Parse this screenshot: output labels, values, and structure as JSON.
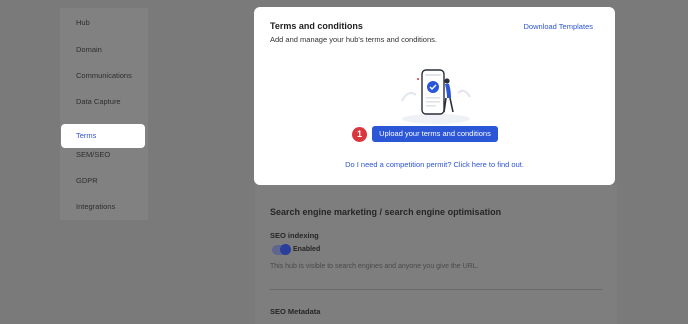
{
  "sidebar": {
    "items": [
      {
        "label": "Hub"
      },
      {
        "label": "Domain"
      },
      {
        "label": "Communications"
      },
      {
        "label": "Data Capture"
      },
      {
        "label": "Terms"
      },
      {
        "label": "SEM/SEO"
      },
      {
        "label": "GDPR"
      },
      {
        "label": "Integrations"
      }
    ],
    "active_index": 4
  },
  "background": {
    "section_heading": "Search engine marketing / search engine optimisation",
    "seo_indexing": {
      "label": "SEO indexing",
      "toggle_label": "Enabled",
      "enabled": true,
      "help": "This hub is visible to search engines and anyone you give the URL."
    },
    "seo_metadata_label": "SEO Metadata"
  },
  "modal": {
    "title": "Terms and conditions",
    "description": "Add and manage your hub's terms and conditions.",
    "download_label": "Download Templates",
    "step_number": "1",
    "upload_label": "Upload your terms and conditions",
    "permit_link": "Do I need a competition permit? Click here to find out."
  },
  "colors": {
    "overlay": "#7a7a7a",
    "primary": "#2b56d5",
    "link": "#2d55d4",
    "badge": "#d9363e"
  },
  "icons": {
    "illustration": "phone-with-person-illustration"
  }
}
